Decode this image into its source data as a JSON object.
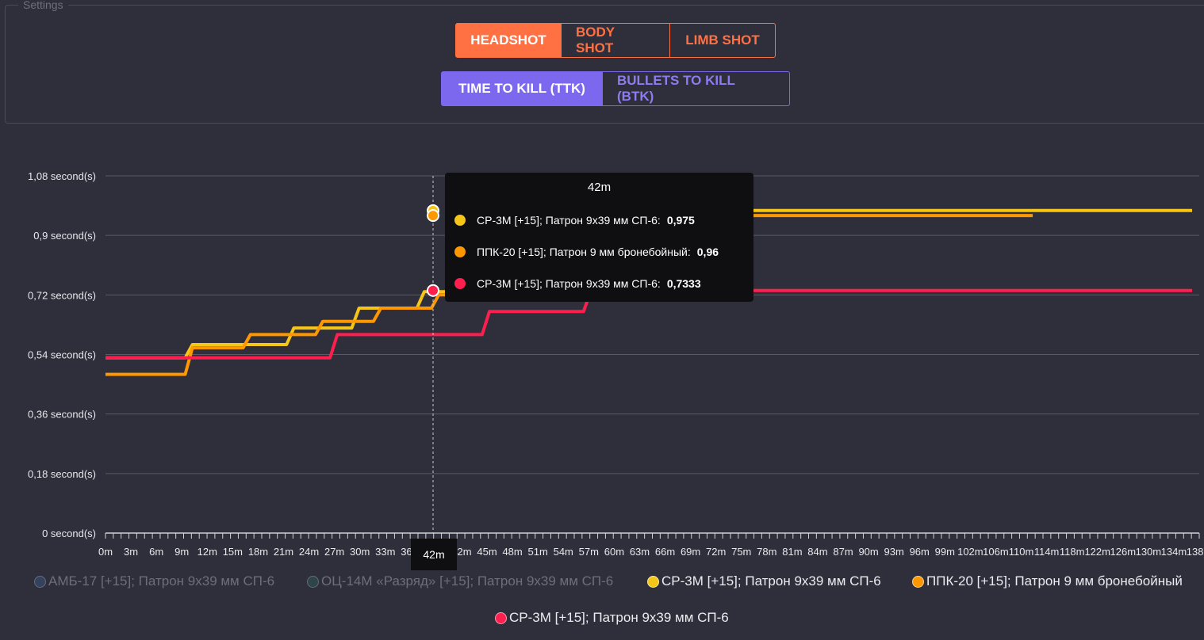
{
  "settings": {
    "legend": "Settings"
  },
  "shot_buttons": [
    {
      "label": "HEADSHOT",
      "active": true
    },
    {
      "label": "BODY SHOT",
      "active": false
    },
    {
      "label": "LIMB SHOT",
      "active": false
    }
  ],
  "mode_buttons": [
    {
      "label": "TIME TO KILL (TTK)",
      "active": true
    },
    {
      "label": "BULLETS TO KILL (BTK)",
      "active": false
    }
  ],
  "tooltip": {
    "title": "42m",
    "rows": [
      {
        "label": "СР-3М [+15]; Патрон 9x39 мм СП-6:",
        "value": "0,975",
        "color": "#f5c518"
      },
      {
        "label": "ППК-20 [+15]; Патрон 9 мм бронебойный:",
        "value": "0,96",
        "color": "#ff9800"
      },
      {
        "label": "СР-3М [+15]; Патрон 9x39 мм СП-6:",
        "value": "0,7333",
        "color": "#ff1f4f"
      }
    ]
  },
  "x_marker": "42m",
  "legend": [
    {
      "label": "АМБ-17 [+15]; Патрон 9x39 мм СП-6",
      "color": "#3d5a8a",
      "shown": false
    },
    {
      "label": "ОЦ-14М «Разряд» [+15]; Патрон 9x39 мм СП-6",
      "color": "#2e5e5a",
      "shown": false
    },
    {
      "label": "СР-3М [+15]; Патрон 9x39 мм СП-6",
      "color": "#f5c518",
      "shown": true
    },
    {
      "label": "ППК-20 [+15]; Патрон 9 мм бронебойный",
      "color": "#ff9800",
      "shown": true
    },
    {
      "label": "СР-3М [+15]; Патрон 9x39 мм СП-6",
      "color": "#ff1f4f",
      "shown": true
    }
  ],
  "chart_data": {
    "type": "line",
    "y_ticks": [
      "0 second(s)",
      "0,18 second(s)",
      "0,36 second(s)",
      "0,54 second(s)",
      "0,72 second(s)",
      "0,9 second(s)",
      "1,08 second(s)"
    ],
    "ylim": [
      0,
      1.08
    ],
    "x_tick_labels": [
      "0m",
      "3m",
      "6m",
      "9m",
      "12m",
      "15m",
      "18m",
      "21m",
      "24m",
      "27m",
      "30m",
      "33m",
      "36m",
      "39m",
      "42m",
      "45m",
      "48m",
      "51m",
      "54m",
      "57m",
      "60m",
      "63m",
      "66m",
      "69m",
      "72m",
      "75m",
      "78m",
      "81m",
      "84m",
      "87m",
      "90m",
      "93m",
      "96m",
      "99m",
      "102m",
      "106m",
      "110m",
      "114m",
      "118m",
      "122m",
      "126m",
      "130m",
      "134m",
      "138m"
    ],
    "xlim": [
      0,
      138
    ],
    "hover_x": 42,
    "series": [
      {
        "name": "СР-3М [+15]; Патрон 9x39 мм СП-6",
        "color": "#f5c518",
        "points": [
          [
            0,
            0.53
          ],
          [
            11,
            0.53
          ],
          [
            12,
            0.57
          ],
          [
            25,
            0.57
          ],
          [
            26,
            0.62
          ],
          [
            34,
            0.62
          ],
          [
            35,
            0.68
          ],
          [
            43,
            0.68
          ],
          [
            44,
            0.73
          ],
          [
            51,
            0.73
          ],
          [
            52,
            0.78
          ],
          [
            59,
            0.78
          ],
          [
            60,
            0.83
          ],
          [
            67,
            0.83
          ],
          [
            68,
            0.88
          ],
          [
            75,
            0.88
          ],
          [
            76,
            0.93
          ],
          [
            83,
            0.93
          ],
          [
            84,
            0.975
          ],
          [
            150,
            0.975
          ]
        ]
      },
      {
        "name": "ППК-20 [+15]; Патрон 9 мм бронебойный",
        "color": "#ff9800",
        "points": [
          [
            0,
            0.48
          ],
          [
            11,
            0.48
          ],
          [
            12,
            0.56
          ],
          [
            19,
            0.56
          ],
          [
            20,
            0.6
          ],
          [
            29,
            0.6
          ],
          [
            30,
            0.64
          ],
          [
            37,
            0.64
          ],
          [
            38,
            0.68
          ],
          [
            45,
            0.68
          ],
          [
            46,
            0.72
          ],
          [
            53,
            0.72
          ],
          [
            54,
            0.8
          ],
          [
            61,
            0.8
          ],
          [
            62,
            0.84
          ],
          [
            69,
            0.84
          ],
          [
            70,
            0.88
          ],
          [
            77,
            0.88
          ],
          [
            78,
            0.96
          ],
          [
            128,
            0.96
          ]
        ]
      },
      {
        "name": "СР-3М [+15]; Патрон 9x39 мм СП-6",
        "color": "#ff1f4f",
        "points": [
          [
            0,
            0.53
          ],
          [
            31,
            0.53
          ],
          [
            32,
            0.6
          ],
          [
            52,
            0.6
          ],
          [
            53,
            0.67
          ],
          [
            66,
            0.67
          ],
          [
            67,
            0.7333
          ],
          [
            150,
            0.7333
          ]
        ]
      }
    ],
    "x_unit_note": "",
    "grid": true,
    "legend_position": "bottom"
  }
}
